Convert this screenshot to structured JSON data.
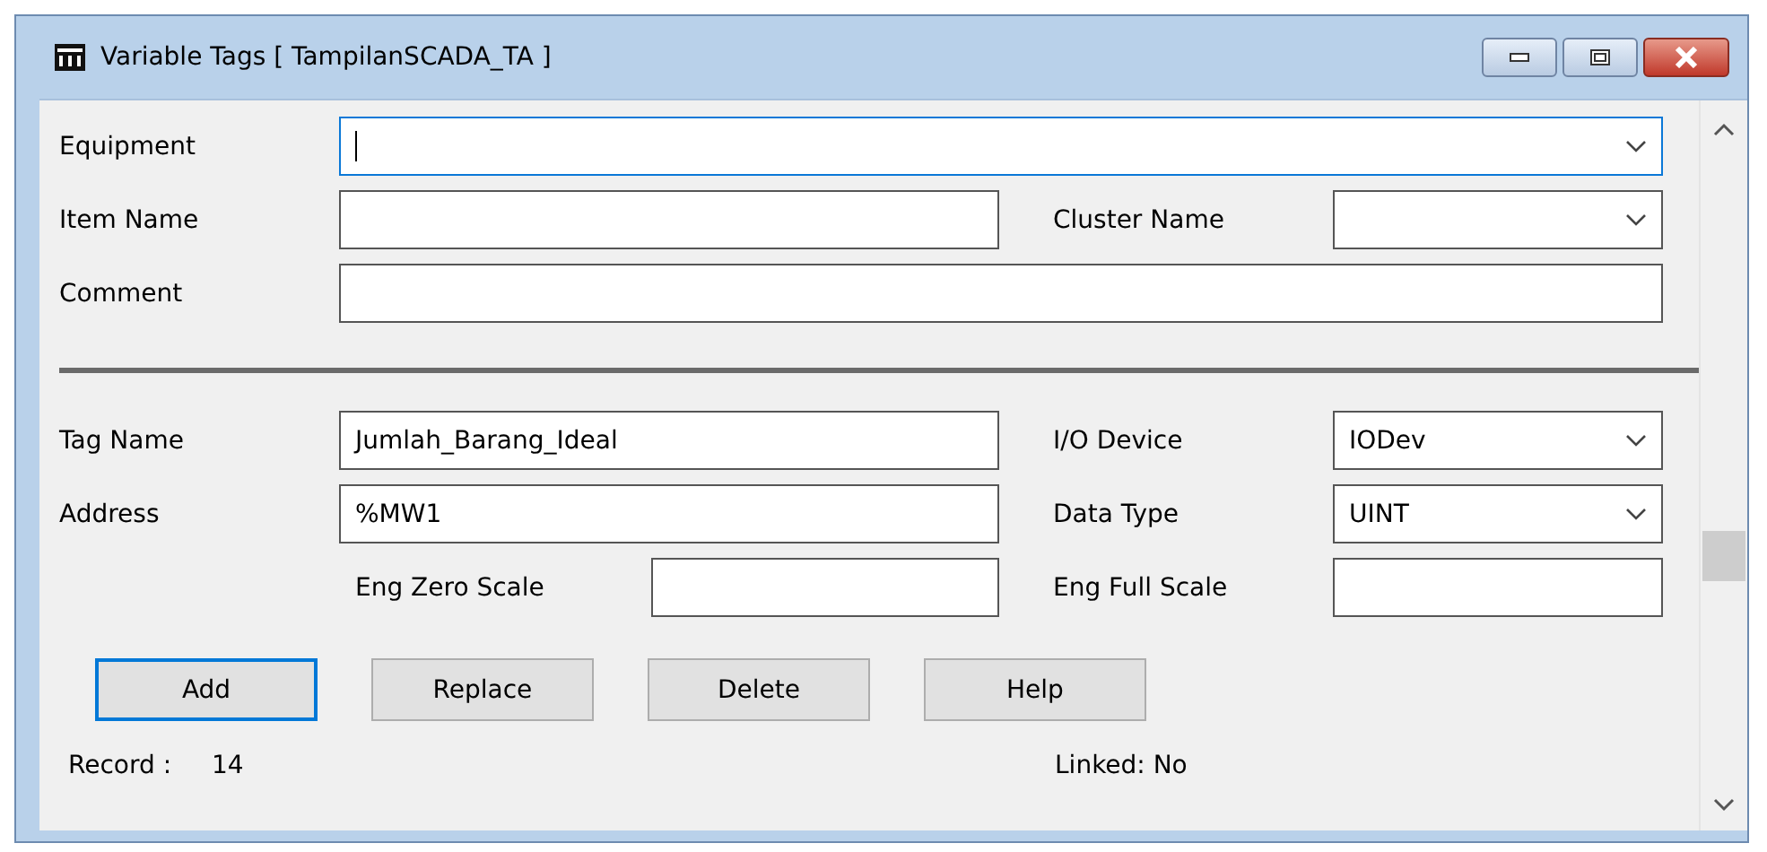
{
  "window": {
    "title": "Variable Tags [ TampilanSCADA_TA ]"
  },
  "sections": [
    {
      "rows": [
        [
          {
            "kind": "combo",
            "label": "Equipment",
            "wide": true,
            "focused": true
          }
        ],
        [
          {
            "kind": "text",
            "label": "Item Name",
            "focused": false
          },
          {
            "kind": "combo",
            "label": "Cluster Name",
            "focused": false
          }
        ],
        [
          {
            "kind": "text",
            "label": "Comment",
            "wide": true,
            "focused": false
          }
        ]
      ]
    },
    {
      "rows": [
        [
          {
            "kind": "text",
            "label": "Tag Name",
            "value": "Jumlah_Barang_Ideal",
            "focused": false
          },
          {
            "kind": "combo",
            "label": "I/O Device",
            "value": "IODev",
            "focused": false
          }
        ],
        [
          {
            "kind": "text",
            "label": "Address",
            "value": "%MW1",
            "focused": false
          },
          {
            "kind": "combo",
            "label": "Data Type",
            "value": "UINT",
            "focused": false
          }
        ],
        [
          {
            "kind": "inset",
            "label": "Eng Zero Scale",
            "focused": false
          },
          {
            "kind": "text",
            "label": "Eng Full Scale",
            "focused": false
          }
        ]
      ]
    }
  ],
  "buttons": [
    {
      "label": "Add",
      "default": true
    },
    {
      "label": "Replace",
      "default": false
    },
    {
      "label": "Delete",
      "default": false
    },
    {
      "label": "Help",
      "default": false
    }
  ],
  "status": {
    "record_label": "Record :",
    "record_value": "14",
    "linked": "Linked: No"
  }
}
